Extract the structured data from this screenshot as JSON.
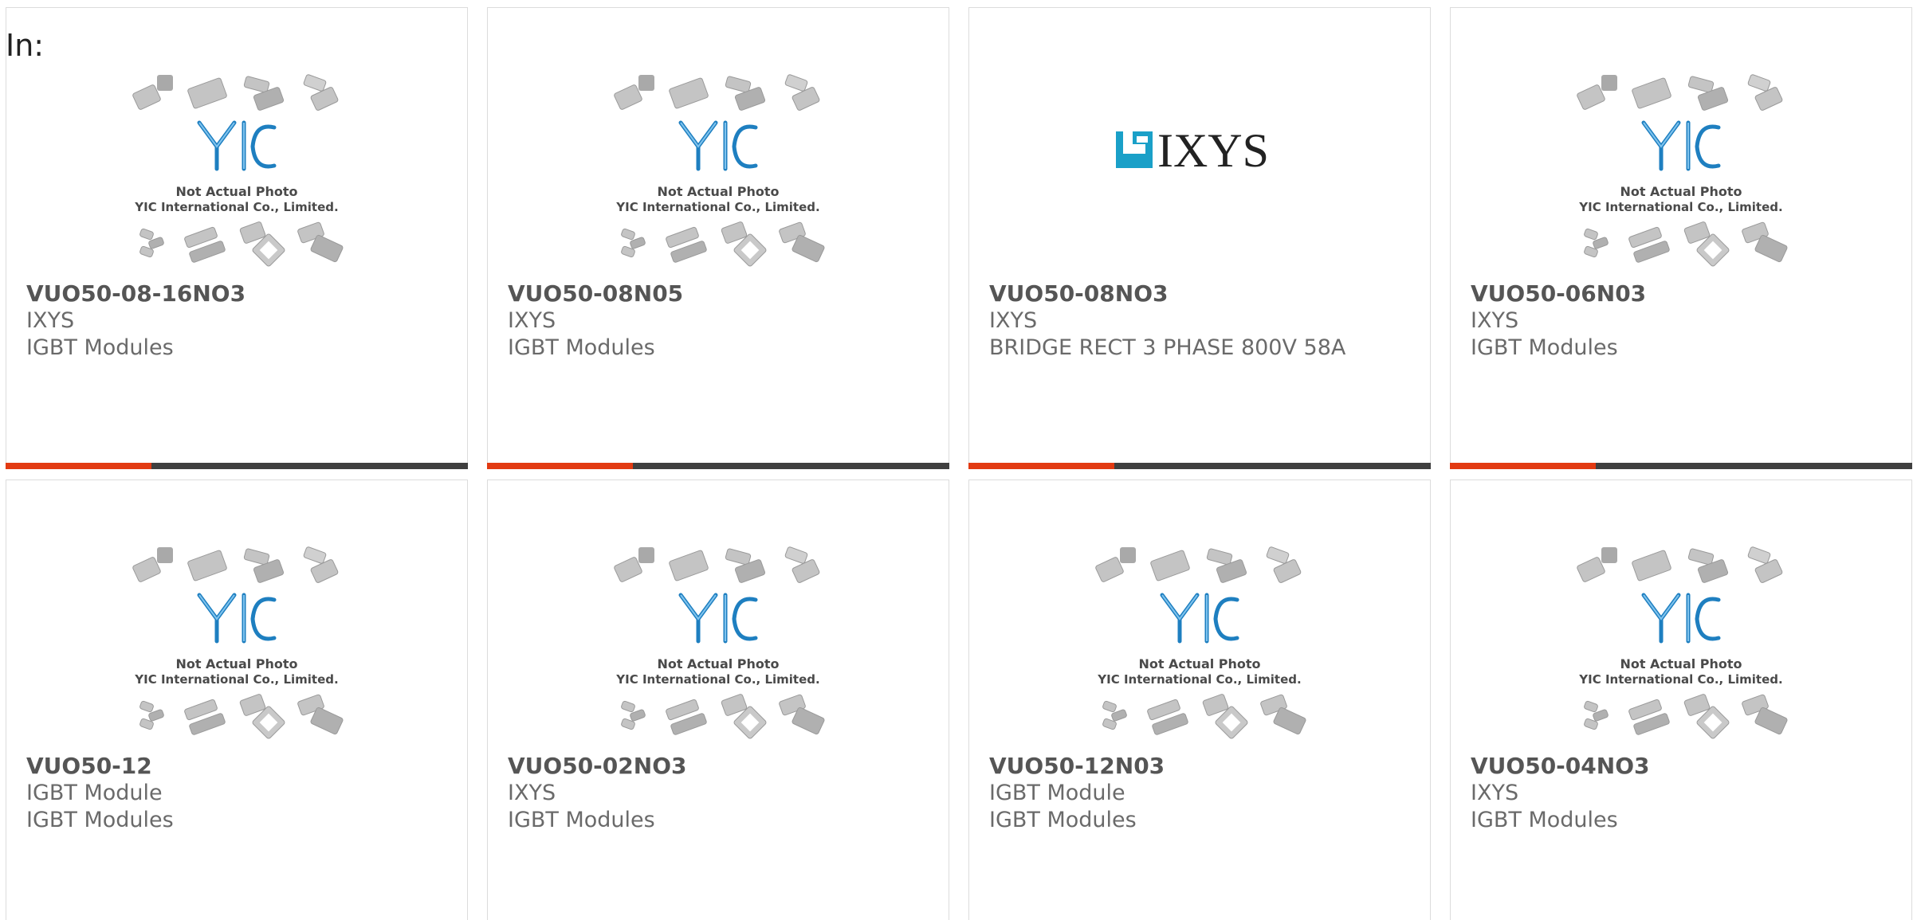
{
  "header": {
    "label": "In:"
  },
  "placeholder_image": {
    "line1": "Not Actual Photo",
    "line2": "YIC International Co., Limited."
  },
  "ixys_logo_text": "IXYS",
  "colors": {
    "accent_red": "#e23a12",
    "bar_dark": "#3f3f3f",
    "yic_blue": "#1e7fc0",
    "ixys_teal": "#1aa0c8"
  },
  "products": [
    {
      "part": "VUO50-08-16NO3",
      "manufacturer": "IXYS",
      "category": "IGBT Modules",
      "image": "yic-placeholder",
      "has_bar": true
    },
    {
      "part": "VUO50-08N05",
      "manufacturer": "IXYS",
      "category": "IGBT Modules",
      "image": "yic-placeholder",
      "has_bar": true
    },
    {
      "part": "VUO50-08NO3",
      "manufacturer": "IXYS",
      "category": "BRIDGE RECT 3 PHASE 800V 58A",
      "image": "ixys-logo",
      "has_bar": true
    },
    {
      "part": "VUO50-06N03",
      "manufacturer": "IXYS",
      "category": "IGBT Modules",
      "image": "yic-placeholder",
      "has_bar": true
    },
    {
      "part": "VUO50-12",
      "manufacturer": "IGBT Module",
      "category": "IGBT Modules",
      "image": "yic-placeholder",
      "has_bar": false
    },
    {
      "part": "VUO50-02NO3",
      "manufacturer": "IXYS",
      "category": "IGBT Modules",
      "image": "yic-placeholder",
      "has_bar": false
    },
    {
      "part": "VUO50-12N03",
      "manufacturer": "IGBT Module",
      "category": "IGBT Modules",
      "image": "yic-placeholder",
      "has_bar": false
    },
    {
      "part": "VUO50-04NO3",
      "manufacturer": "IXYS",
      "category": "IGBT Modules",
      "image": "yic-placeholder",
      "has_bar": false
    }
  ]
}
